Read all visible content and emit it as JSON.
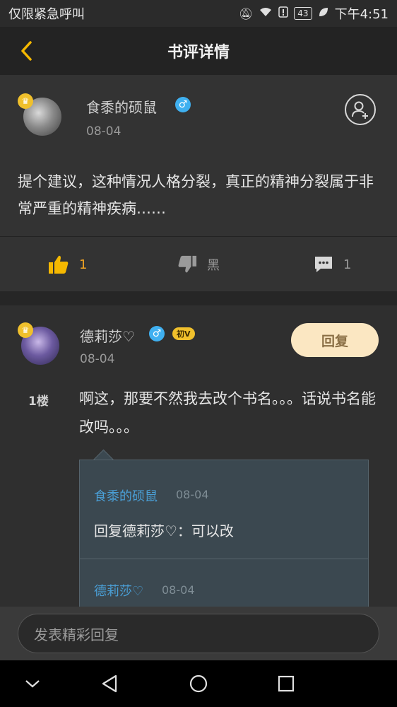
{
  "status_bar": {
    "left_text": "仅限紧急呼叫",
    "battery": "43",
    "time": "下午4:51",
    "icons": [
      "mute-icon",
      "wifi-icon",
      "alert-icon",
      "battery-icon",
      "leaf-icon"
    ]
  },
  "header": {
    "title": "书评详情",
    "back_icon": "chevron-left-icon",
    "accent_color": "#f5b800"
  },
  "post": {
    "author": "食黍的硕鼠",
    "gender_symbol": "♂",
    "date": "08-04",
    "content": "提个建议，这种情况人格分裂，真正的精神分裂属于非常严重的精神疾病……",
    "like_count": "1",
    "dislike_label": "黑",
    "comment_count": "1"
  },
  "comment": {
    "author": "德莉莎♡",
    "gender_symbol": "♂",
    "level_badge": "初V",
    "date": "08-04",
    "reply_label": "回复",
    "floor": "1楼",
    "content": "啊这，那要不然我去改个书名。。。话说书名能改吗。。。",
    "replies": [
      {
        "author": "食黍的硕鼠",
        "date": "08-04",
        "text": "回复德莉莎♡：可以改"
      },
      {
        "author": "德莉莎♡",
        "date": "08-04",
        "text": ""
      }
    ]
  },
  "input": {
    "placeholder": "发表精彩回复"
  },
  "nav_bar": {
    "icons": [
      "collapse-icon",
      "back-triangle-icon",
      "home-circle-icon",
      "recents-square-icon"
    ]
  }
}
